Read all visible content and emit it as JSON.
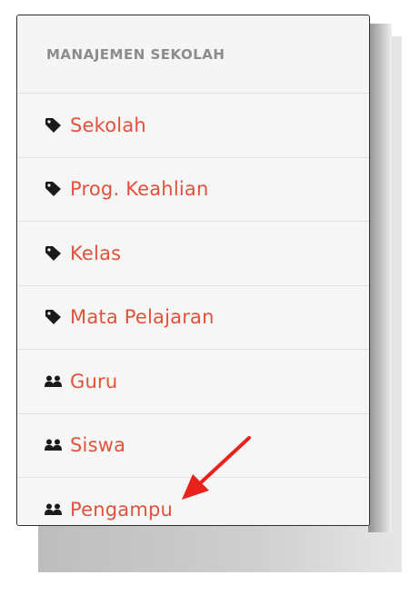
{
  "menu": {
    "header": "MANAJEMEN SEKOLAH",
    "items": [
      {
        "label": "Sekolah",
        "icon": "tag-icon"
      },
      {
        "label": "Prog. Keahlian",
        "icon": "tag-icon"
      },
      {
        "label": "Kelas",
        "icon": "tag-icon"
      },
      {
        "label": "Mata Pelajaran",
        "icon": "tag-icon"
      },
      {
        "label": "Guru",
        "icon": "users-icon"
      },
      {
        "label": "Siswa",
        "icon": "users-icon"
      },
      {
        "label": "Pengampu",
        "icon": "users-icon"
      }
    ]
  },
  "colors": {
    "link": "#e2513a",
    "header_text": "#8c8c8c",
    "panel_bg": "#f6f6f6",
    "annotation_arrow": "#e8231b"
  }
}
